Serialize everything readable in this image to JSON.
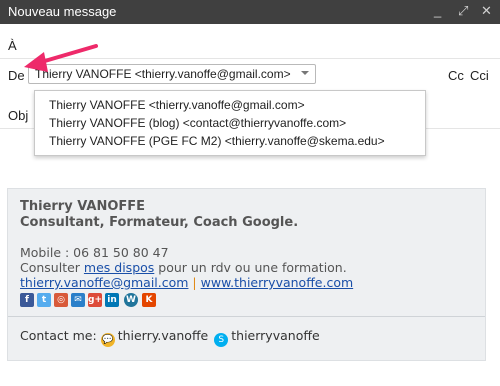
{
  "window": {
    "title": "Nouveau message",
    "controls": [
      "_",
      "⤢",
      "✕"
    ]
  },
  "compose": {
    "to_label": "À",
    "from_label": "De",
    "from_value": "Thierry VANOFFE <thierry.vanoffe@gmail.com>",
    "cc_label": "Cc",
    "bcc_label": "Cci",
    "subject_label_partial": "Obj"
  },
  "from_options": [
    "Thierry VANOFFE <thierry.vanoffe@gmail.com>",
    "Thierry VANOFFE (blog) <contact@thierryvanoffe.com>",
    "Thierry VANOFFE (PGE FC M2) <thierry.vanoffe@skema.edu>"
  ],
  "signature": {
    "name": "Thierry VANOFFE",
    "role": "Consultant, Formateur, Coach Google.",
    "mobile": "Mobile : 06 81 50 80 47",
    "consult_prefix": "Consulter ",
    "consult_link": "mes dispos",
    "consult_suffix": " pour un rdv ou une formation.",
    "email_link": "thierry.vanoffe@gmail.com",
    "pipe": " | ",
    "site_link": "www.thierryvanoffe.com",
    "social_icons": [
      {
        "name": "facebook-icon",
        "glyph": "f",
        "color": "#3b5998"
      },
      {
        "name": "twitter-icon",
        "glyph": "t",
        "color": "#55acee"
      },
      {
        "name": "instagram-icon",
        "glyph": "◎",
        "color": "#d85a3a"
      },
      {
        "name": "email-icon",
        "glyph": "✉",
        "color": "#2a7fc9"
      },
      {
        "name": "google-plus-icon",
        "glyph": "g+",
        "color": "#dd4b39"
      },
      {
        "name": "linkedin-icon",
        "glyph": "in",
        "color": "#0077b5"
      },
      {
        "name": "wordpress-icon",
        "glyph": "W",
        "color": "#21759b"
      },
      {
        "name": "klout-icon",
        "glyph": "K",
        "color": "#e44600"
      }
    ],
    "contact_label": "Contact me:",
    "hangouts_id": "thierry.vanoffe",
    "skype_id": "thierryvanoffe"
  },
  "colors": {
    "titlebar": "#404040",
    "arrow": "#ee2a6a",
    "link": "#1a4fa8"
  }
}
